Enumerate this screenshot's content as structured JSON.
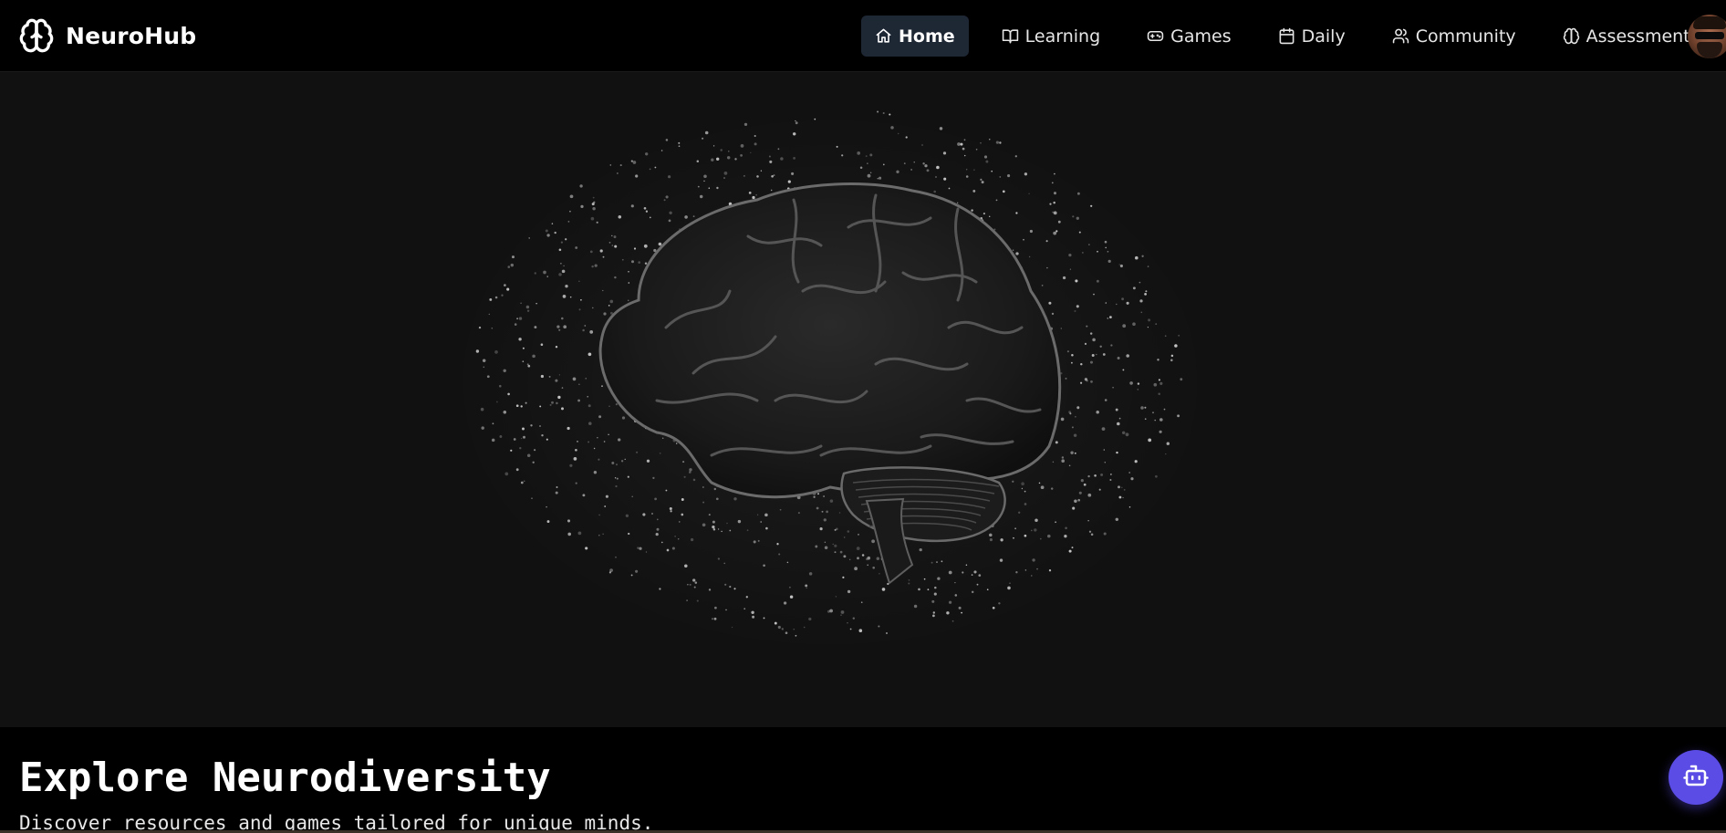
{
  "brand": {
    "name": "NeuroHub",
    "icon": "brain-icon"
  },
  "nav": {
    "items": [
      {
        "label": "Home",
        "icon": "home-icon",
        "active": true
      },
      {
        "label": "Learning",
        "icon": "book-icon",
        "active": false
      },
      {
        "label": "Games",
        "icon": "gamepad-icon",
        "active": false
      },
      {
        "label": "Daily",
        "icon": "calendar-icon",
        "active": false
      },
      {
        "label": "Community",
        "icon": "users-icon",
        "active": false
      },
      {
        "label": "Assessment",
        "icon": "brain-icon",
        "active": false
      }
    ]
  },
  "user": {
    "avatar": "user-avatar"
  },
  "hero": {
    "image": "particle-brain-illustration"
  },
  "intro": {
    "headline": "Explore Neurodiversity",
    "subline": "Discover resources and games tailored for unique minds."
  },
  "assistant": {
    "icon": "bot-icon"
  },
  "colors": {
    "page_bg": "#000000",
    "hero_bg": "#111111",
    "nav_active_bg": "#1e2734",
    "fab_bg": "#5b4ce6",
    "text": "#ffffff"
  }
}
